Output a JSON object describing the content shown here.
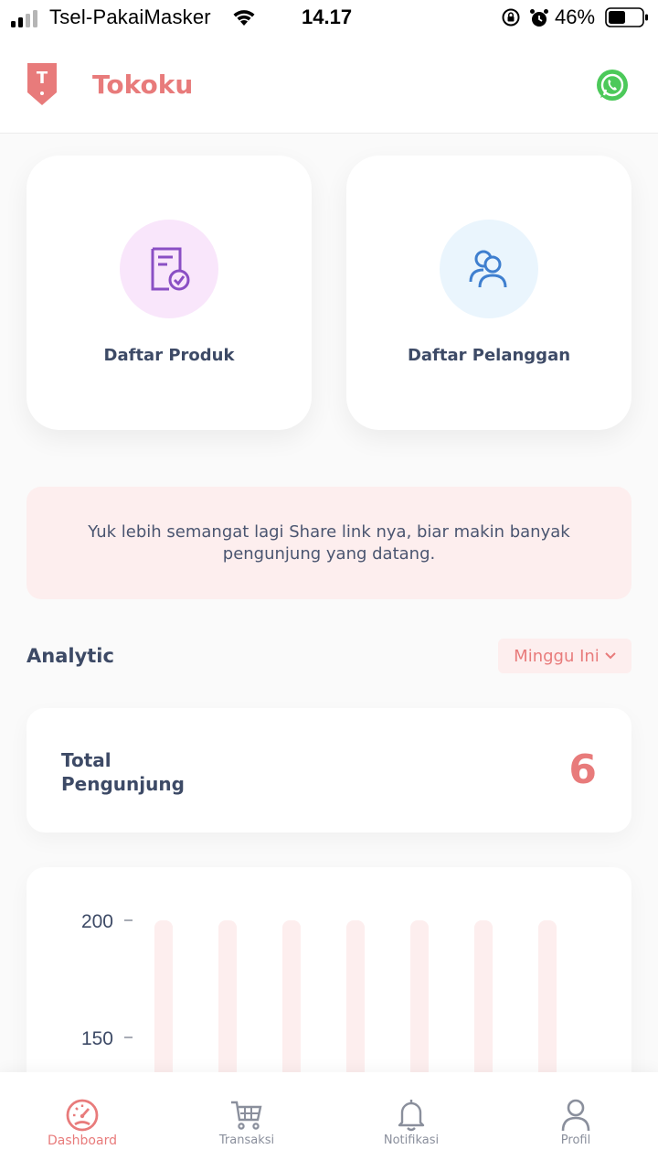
{
  "status_bar": {
    "carrier": "Tsel-PakaiMasker",
    "time": "14.17",
    "battery": "46%"
  },
  "header": {
    "logo_letter": "T",
    "title": "Tokoku"
  },
  "menu": {
    "products_label": "Daftar Produk",
    "customers_label": "Daftar Pelanggan"
  },
  "banner": {
    "text": "Yuk lebih semangat lagi Share link nya, biar makin banyak pengunjung yang datang."
  },
  "analytic": {
    "title": "Analytic",
    "period": "Minggu Ini"
  },
  "visitors": {
    "label": "Total Pengunjung",
    "value": "6"
  },
  "chart_data": {
    "type": "bar",
    "y_ticks": [
      "200",
      "150"
    ],
    "bar_count": 7,
    "bar_color": "#fdeeee"
  },
  "nav": {
    "dashboard": "Dashboard",
    "transactions": "Transaksi",
    "notifications": "Notifikasi",
    "profile": "Profil"
  },
  "colors": {
    "accent": "#e87b7b",
    "text": "#3d4a66",
    "whatsapp": "#4cc95a"
  }
}
